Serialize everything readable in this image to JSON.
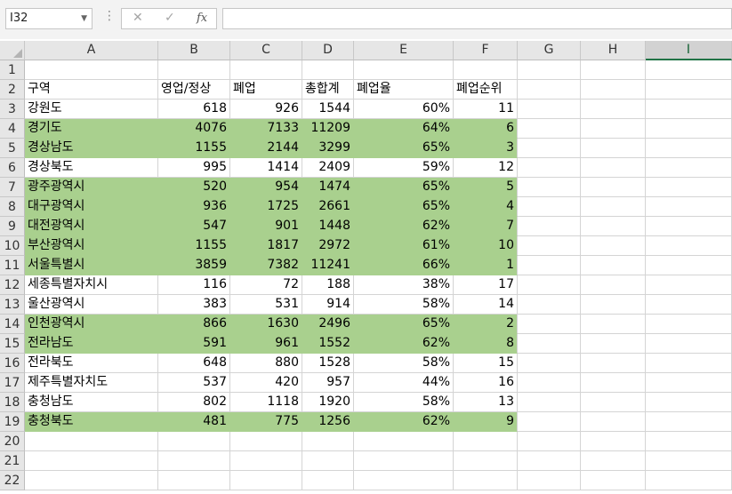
{
  "formula_bar": {
    "name_box": "I32",
    "cancel_icon": "✕",
    "enter_icon": "✓",
    "fx_label": "fx",
    "formula": ""
  },
  "columns": [
    "A",
    "B",
    "C",
    "D",
    "E",
    "F",
    "G",
    "H",
    "I"
  ],
  "selected_column": "I",
  "row_numbers": [
    "1",
    "2",
    "3",
    "4",
    "5",
    "6",
    "7",
    "8",
    "9",
    "10",
    "11",
    "12",
    "13",
    "14",
    "15",
    "16",
    "17",
    "18",
    "19",
    "20",
    "21",
    "22"
  ],
  "header_row": [
    "구역",
    "영업/정상",
    "폐업",
    "총합계",
    "폐업율",
    "폐업순위"
  ],
  "highlight_color": "#a9d08e",
  "data_rows": [
    {
      "cells": [
        "강원도",
        "618",
        "926",
        "1544",
        "60%",
        "11"
      ],
      "highlight": false
    },
    {
      "cells": [
        "경기도",
        "4076",
        "7133",
        "11209",
        "64%",
        "6"
      ],
      "highlight": true
    },
    {
      "cells": [
        "경상남도",
        "1155",
        "2144",
        "3299",
        "65%",
        "3"
      ],
      "highlight": true
    },
    {
      "cells": [
        "경상북도",
        "995",
        "1414",
        "2409",
        "59%",
        "12"
      ],
      "highlight": false
    },
    {
      "cells": [
        "광주광역시",
        "520",
        "954",
        "1474",
        "65%",
        "5"
      ],
      "highlight": true
    },
    {
      "cells": [
        "대구광역시",
        "936",
        "1725",
        "2661",
        "65%",
        "4"
      ],
      "highlight": true
    },
    {
      "cells": [
        "대전광역시",
        "547",
        "901",
        "1448",
        "62%",
        "7"
      ],
      "highlight": true
    },
    {
      "cells": [
        "부산광역시",
        "1155",
        "1817",
        "2972",
        "61%",
        "10"
      ],
      "highlight": true
    },
    {
      "cells": [
        "서울특별시",
        "3859",
        "7382",
        "11241",
        "66%",
        "1"
      ],
      "highlight": true
    },
    {
      "cells": [
        "세종특별자치시",
        "116",
        "72",
        "188",
        "38%",
        "17"
      ],
      "highlight": false
    },
    {
      "cells": [
        "울산광역시",
        "383",
        "531",
        "914",
        "58%",
        "14"
      ],
      "highlight": false
    },
    {
      "cells": [
        "인천광역시",
        "866",
        "1630",
        "2496",
        "65%",
        "2"
      ],
      "highlight": true
    },
    {
      "cells": [
        "전라남도",
        "591",
        "961",
        "1552",
        "62%",
        "8"
      ],
      "highlight": true
    },
    {
      "cells": [
        "전라북도",
        "648",
        "880",
        "1528",
        "58%",
        "15"
      ],
      "highlight": false
    },
    {
      "cells": [
        "제주특별자치도",
        "537",
        "420",
        "957",
        "44%",
        "16"
      ],
      "highlight": false
    },
    {
      "cells": [
        "충청남도",
        "802",
        "1118",
        "1920",
        "58%",
        "13"
      ],
      "highlight": false
    },
    {
      "cells": [
        "충청북도",
        "481",
        "775",
        "1256",
        "62%",
        "9"
      ],
      "highlight": true
    }
  ]
}
